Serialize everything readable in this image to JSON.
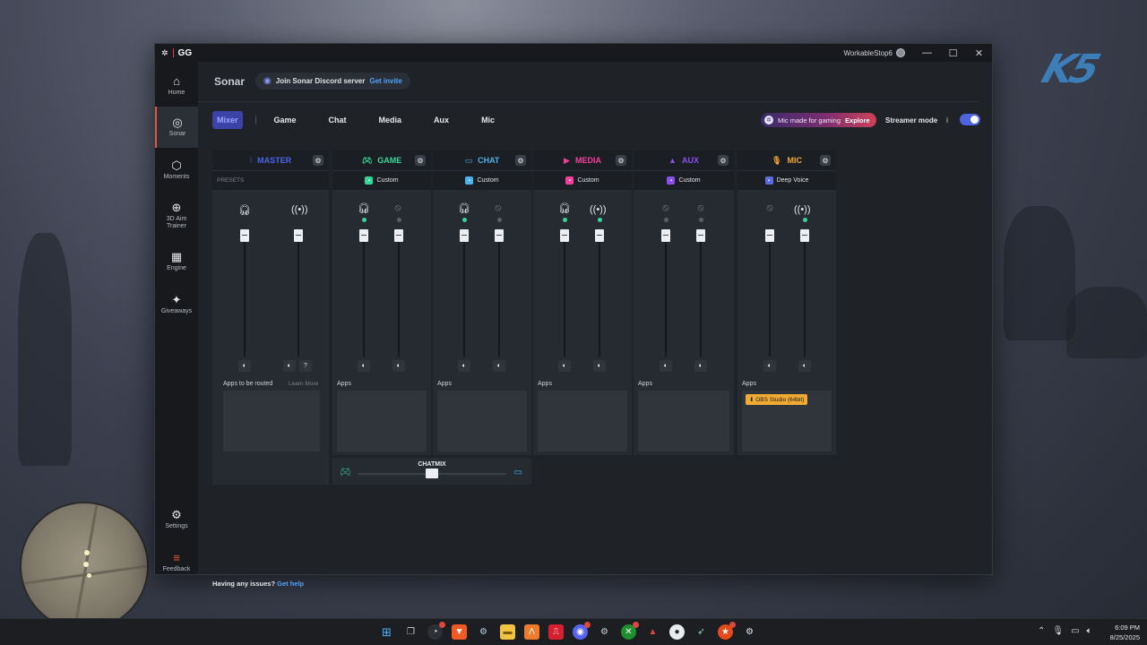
{
  "window": {
    "brand": "GG",
    "username": "WorkableStop6",
    "minimize": "—",
    "maximize": "☐",
    "close": "✕"
  },
  "sidebar": {
    "items": [
      {
        "label": "Home",
        "icon": "home-icon",
        "glyph": "⌂"
      },
      {
        "label": "Sonar",
        "icon": "sonar-icon",
        "glyph": "◎"
      },
      {
        "label": "Moments",
        "icon": "moments-icon",
        "glyph": "⬡"
      },
      {
        "label": "3D Aim Trainer",
        "icon": "aim-trainer-icon",
        "glyph": "⊕"
      },
      {
        "label": "Engine",
        "icon": "engine-icon",
        "glyph": "▦"
      },
      {
        "label": "Giveaways",
        "icon": "giveaways-icon",
        "glyph": "✦"
      },
      {
        "label": "Settings",
        "icon": "gear-icon",
        "glyph": "⚙"
      },
      {
        "label": "Feedback",
        "icon": "feedback-icon",
        "glyph": "≡"
      }
    ]
  },
  "header": {
    "title": "Sonar",
    "discord_text": "Join Sonar Discord server",
    "discord_link": "Get invite"
  },
  "tabs": [
    "Mixer",
    "Game",
    "Chat",
    "Media",
    "Aux",
    "Mic"
  ],
  "promo": {
    "text": "Mic made for gaming",
    "link": "Explore"
  },
  "streamer_mode": {
    "label": "Streamer mode",
    "info": "i",
    "enabled": true
  },
  "channels": [
    {
      "name": "MASTER",
      "color": "#4a63e8",
      "preset": "PRESETS",
      "apps_label": "Apps to be routed",
      "learn_more": "Learn More"
    },
    {
      "name": "GAME",
      "color": "#36d69a",
      "preset": "Custom",
      "apps_label": "Apps"
    },
    {
      "name": "CHAT",
      "color": "#4db2ea",
      "preset": "Custom",
      "apps_label": "Apps"
    },
    {
      "name": "MEDIA",
      "color": "#f0409e",
      "preset": "Custom",
      "apps_label": "Apps"
    },
    {
      "name": "AUX",
      "color": "#8a4ef0",
      "preset": "Custom",
      "apps_label": "Apps"
    },
    {
      "name": "MIC",
      "color": "#f0a932",
      "preset": "Deep Voice",
      "apps_label": "Apps",
      "app": "⬇ OBS Studio (64bit)"
    }
  ],
  "chatmix": {
    "label": "CHATMIX"
  },
  "footer": {
    "help_text": "Having any issues?",
    "help_link": "Get help"
  },
  "taskbar": {
    "time": "6:09 PM",
    "date": "8/25/2025"
  }
}
